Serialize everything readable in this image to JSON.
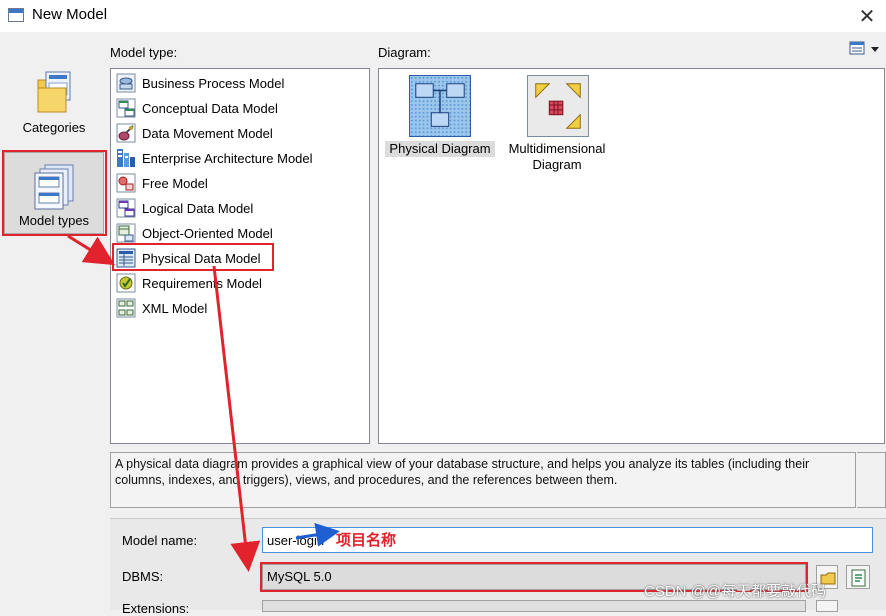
{
  "window": {
    "title": "New Model",
    "close_glyph": "✕"
  },
  "sidebar": {
    "items": [
      {
        "label": "Categories",
        "icon": "categories-folder-icon"
      },
      {
        "label": "Model types",
        "icon": "model-types-icon",
        "selected": true
      }
    ]
  },
  "model_type_panel": {
    "caption": "Model type:",
    "items": [
      {
        "label": "Business Process Model",
        "icon": "business-process-model-icon"
      },
      {
        "label": "Conceptual Data Model",
        "icon": "conceptual-data-model-icon"
      },
      {
        "label": "Data Movement Model",
        "icon": "data-movement-model-icon"
      },
      {
        "label": "Enterprise Architecture Model",
        "icon": "enterprise-architecture-model-icon"
      },
      {
        "label": "Free Model",
        "icon": "free-model-icon"
      },
      {
        "label": "Logical Data Model",
        "icon": "logical-data-model-icon"
      },
      {
        "label": "Object-Oriented Model",
        "icon": "object-oriented-model-icon"
      },
      {
        "label": "Physical Data Model",
        "icon": "physical-data-model-icon",
        "selected": true
      },
      {
        "label": "Requirements Model",
        "icon": "requirements-model-icon"
      },
      {
        "label": "XML Model",
        "icon": "xml-model-icon"
      }
    ]
  },
  "diagram_panel": {
    "caption": "Diagram:",
    "items": [
      {
        "label": "Physical Diagram",
        "icon": "physical-diagram-icon",
        "selected": true
      },
      {
        "label_line1": "Multidimensional",
        "label_line2": "Diagram",
        "icon": "multidimensional-diagram-icon"
      }
    ]
  },
  "description": "A physical data diagram provides a graphical view of your database structure, and helps you analyze its tables (including their columns, indexes, and triggers), views, and procedures, and the references between them.",
  "form": {
    "model_name_label": "Model name:",
    "model_name_value": "user-login",
    "dbms_label": "DBMS:",
    "dbms_value": "MySQL 5.0",
    "extensions_label": "Extensions:"
  },
  "annotation": {
    "text": "项目名称",
    "color": "#e0232c"
  },
  "watermark": "CSDN @@每天都要敲代码",
  "colors": {
    "highlight": "#e0232c",
    "arrow_blue": "#1f5fd1",
    "selection": "#dcdcdc",
    "input_focus": "#4a90e2"
  }
}
